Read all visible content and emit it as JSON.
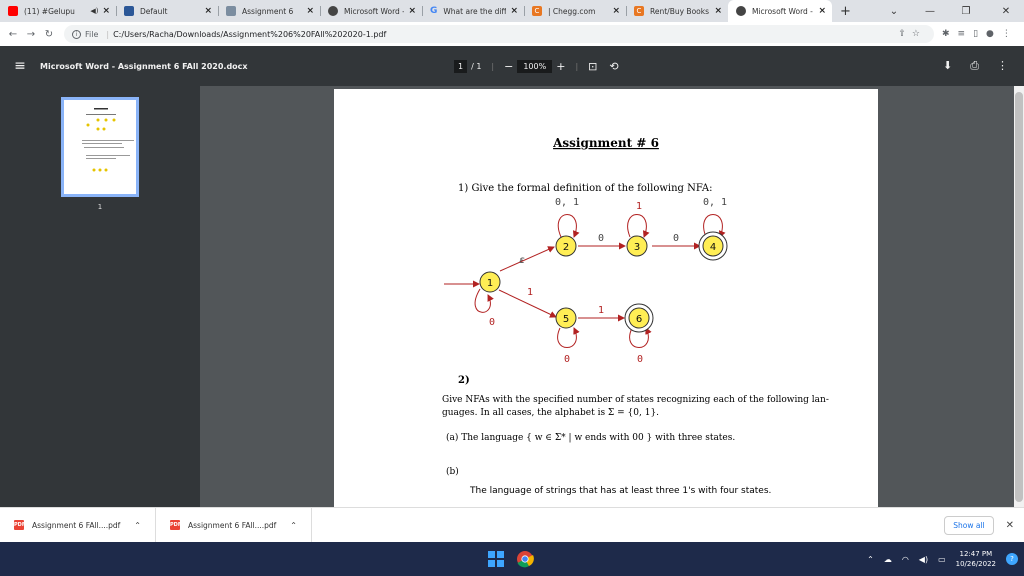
{
  "tabs": [
    {
      "label": "(11) #Gelupu",
      "icon": "youtube-icon",
      "color": "#ff0000",
      "active": false
    },
    {
      "label": "Default",
      "icon": "page-icon",
      "color": "#2b5797",
      "active": false
    },
    {
      "label": "Assignment 6",
      "icon": "document-icon",
      "color": "#7b8da0",
      "active": false
    },
    {
      "label": "Microsoft Word -",
      "icon": "globe-icon",
      "color": "#444444",
      "active": false
    },
    {
      "label": "What are the diff",
      "icon": "google-icon",
      "color": "#4285f4",
      "active": false
    },
    {
      "label": "| Chegg.com",
      "icon": "chegg-icon",
      "color": "#e87722",
      "active": false
    },
    {
      "label": "Rent/Buy Books",
      "icon": "chegg-icon",
      "color": "#e87722",
      "active": false
    },
    {
      "label": "Microsoft Word -",
      "icon": "globe-icon",
      "color": "#444444",
      "active": true
    }
  ],
  "address": {
    "scheme": "File",
    "url": "C:/Users/Racha/Downloads/Assignment%206%20FAll%202020-1.pdf"
  },
  "pdf": {
    "title": "Microsoft Word - Assignment 6 FAll 2020.docx",
    "page_current": "1",
    "page_total": "/ 1",
    "zoom": "100%",
    "thumb_page": "1"
  },
  "doc": {
    "title": "Assignment # 6",
    "q1": "1) Give the formal definition of the following NFA:",
    "q2_num": "2)",
    "q2_text_1": "Give NFAs with the specified number of states recognizing each of the following lan-",
    "q2_text_2": "guages. In all cases, the alphabet is Σ = {0, 1}.",
    "q2a": "(a) The language { w ∈ Σ* | w ends with 00 } with three states.",
    "q2b_label": "(b)",
    "q2b": "The language of strings that has at least three 1's with four states.",
    "nfa": {
      "states": [
        "1",
        "2",
        "3",
        "4",
        "5",
        "6"
      ],
      "accept_states": [
        "4",
        "6"
      ],
      "labels": {
        "loop2": "0, 1",
        "loop3": "1",
        "loop4": "0, 1",
        "e12": "ε",
        "e15": "1",
        "loop1": "0",
        "e23": "0",
        "e34": "0",
        "e56": "1",
        "loop5": "0",
        "loop6": "0"
      }
    }
  },
  "downloads": [
    {
      "name": "Assignment 6 FAll....pdf"
    },
    {
      "name": "Assignment 6 FAll....pdf"
    }
  ],
  "show_all": "Show all",
  "clock": {
    "time": "12:47 PM",
    "date": "10/26/2022"
  },
  "colors": {
    "state_fill": "#ffee55",
    "edge": "#b22222",
    "taskbar": "#1e2a4a",
    "pdf_toolbar": "#323639"
  }
}
